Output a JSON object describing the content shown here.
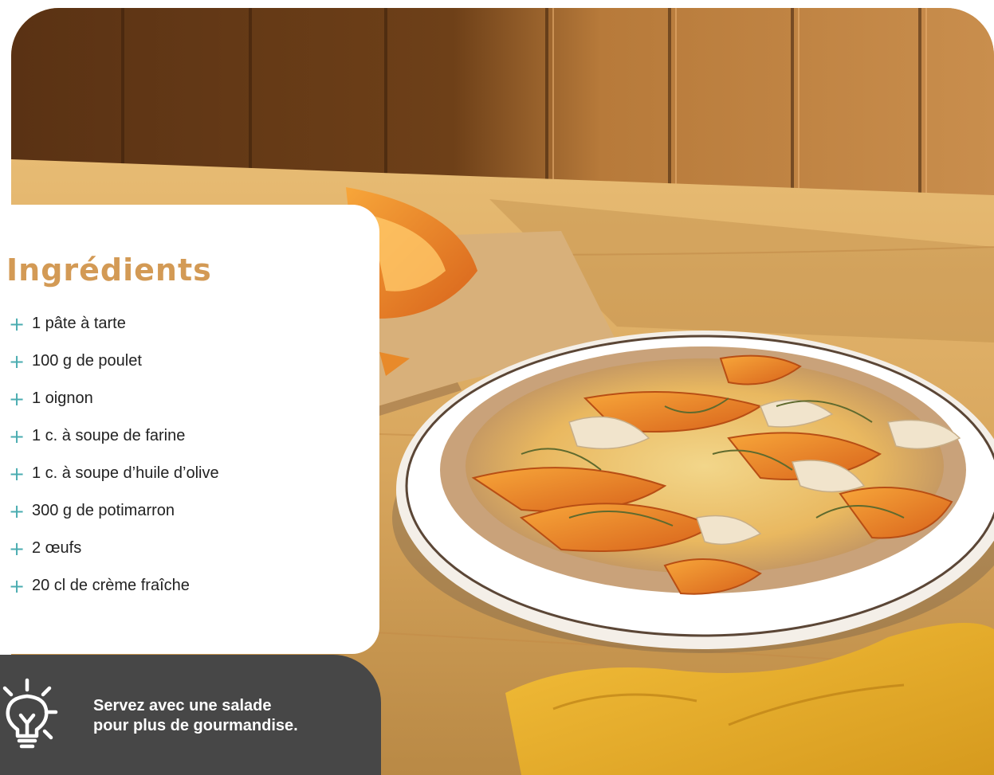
{
  "ingredients": {
    "title": "Ingrédients",
    "accent_color": "#d39a55",
    "bullet_icon": "plus-icon",
    "bullet_color": "#4aacb0",
    "items": [
      "1 pâte à tarte",
      "100 g de poulet",
      "1 oignon",
      "1 c. à soupe de farine",
      "1 c. à soupe d’huile d’olive",
      "300 g de potimarron",
      "2 œufs",
      "20 cl de crème fraîche"
    ]
  },
  "tip": {
    "icon": "lightbulb-icon",
    "line1": "Servez avec une salade",
    "line2": "pour plus de gourmandise.",
    "background_color": "#474747"
  }
}
